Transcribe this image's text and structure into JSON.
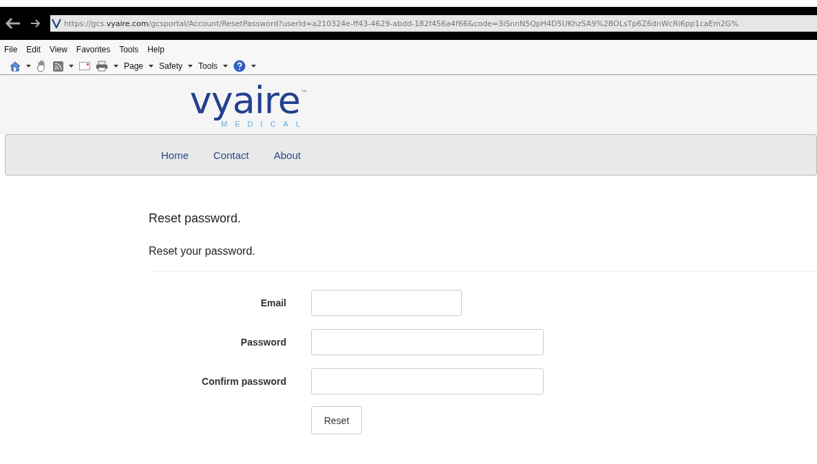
{
  "browser": {
    "url": "https://gcs.**vyaire.com**/gcsportal/Account/ResetPassword?userId=a210324e-ff43-4629-abdd-182f456a4f66&code=3iSnnN5QpH4D5UKhzSA9%2BOLsTp6Z6dnWcRi6pp1caEm2G%",
    "menu": [
      "File",
      "Edit",
      "View",
      "Favorites",
      "Tools",
      "Help"
    ],
    "toolbar": [
      {
        "kind": "home",
        "caret": true
      },
      {
        "kind": "hand",
        "caret": false
      },
      {
        "kind": "feed",
        "caret": true
      },
      {
        "kind": "mail",
        "caret": false
      },
      {
        "kind": "print",
        "caret": true
      },
      {
        "kind": "text",
        "label": "Page",
        "caret": true
      },
      {
        "kind": "text",
        "label": "Safety",
        "caret": true
      },
      {
        "kind": "text",
        "label": "Tools",
        "caret": true
      },
      {
        "kind": "help",
        "caret": true
      }
    ]
  },
  "logo": {
    "name": "vyaire",
    "tm": "™",
    "sub": "MEDICAL"
  },
  "nav": [
    "Home",
    "Contact",
    "About"
  ],
  "heading": "Reset password.",
  "subheading": "Reset your password.",
  "fields": [
    {
      "label": "Email",
      "kind": "short"
    },
    {
      "label": "Password",
      "kind": "long"
    },
    {
      "label": "Confirm password",
      "kind": "long"
    }
  ],
  "button": "Reset"
}
